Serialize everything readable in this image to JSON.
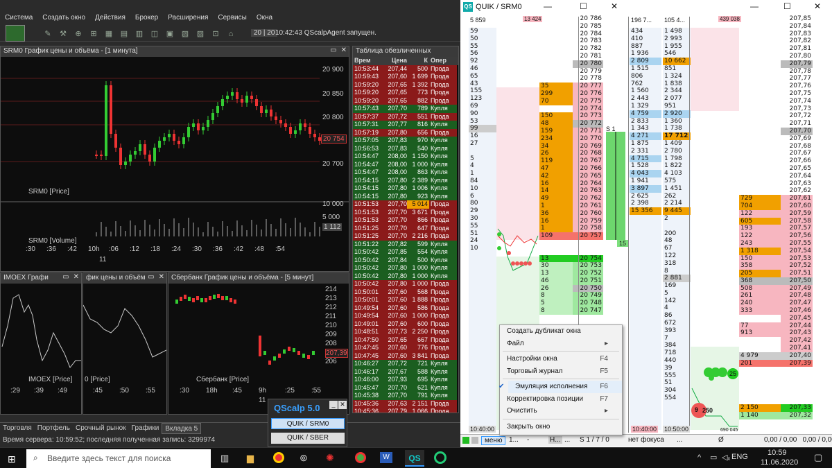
{
  "quik": {
    "menu": [
      "Система",
      "Создать окно",
      "Действия",
      "Брокер",
      "Расширения",
      "Сервисы",
      "Окна"
    ],
    "toolbar_counter": "20 | 20",
    "toolbar_message": "10:42:43 QScalpAgent запущен.",
    "price_chart": {
      "title": "SRM0 График цены и объёма - [1 минута]",
      "price_ticks": [
        "20 900",
        "20 850",
        "20 800",
        "20 754",
        "20 700"
      ],
      "volume_ticks": [
        "10 000",
        "5 000",
        "1 112"
      ],
      "price_legend": "SRM0 [Price]",
      "volume_legend": "SRM0 [Volume]",
      "time_ticks": [
        ":30",
        ":36",
        ":42",
        "10h",
        ":06",
        ":12",
        ":18",
        ":24",
        ":30",
        ":36",
        ":42",
        ":48",
        ":54"
      ],
      "time_sub": "11"
    },
    "imoex_chart": {
      "title": "IMOEX Графи",
      "legend": "IMOEX [Price]",
      "time_ticks": [
        ":29",
        ":39",
        ":49"
      ]
    },
    "mid_chart": {
      "title": "фик цены и объём",
      "legend": "0 [Price]",
      "time_ticks": [
        ":45",
        ":50",
        ":55"
      ]
    },
    "sber_chart": {
      "title": "Сбербанк График цены и объёма - [5 минут]",
      "ticks": [
        "214",
        "213",
        "212",
        "211",
        "210",
        "209",
        "208",
        "207,39",
        "206"
      ],
      "legend": "Сбербанк [Price]",
      "time_ticks": [
        ":30",
        "18h",
        ":45",
        "9h",
        ":25",
        ":55"
      ],
      "time_sub": "11"
    },
    "trades": {
      "title": "Таблица обезличенных",
      "headers": [
        "Врем",
        "Цена",
        "К",
        "Опер"
      ],
      "rows": [
        [
          "10:53:44",
          "207,44",
          "500",
          "Прода",
          "s"
        ],
        [
          "10:59:43",
          "207,60",
          "1 699",
          "Прода",
          "s"
        ],
        [
          "10:59:20",
          "207,65",
          "1 392",
          "Прода",
          "s"
        ],
        [
          "10:59:20",
          "207,65",
          "773",
          "Прода",
          "s"
        ],
        [
          "10:59:20",
          "207,65",
          "882",
          "Прода",
          "s"
        ],
        [
          "10:57:43",
          "207,70",
          "789",
          "Купля",
          "b"
        ],
        [
          "10:57:37",
          "207,72",
          "551",
          "Прода",
          "s"
        ],
        [
          "10:57:31",
          "207,77",
          "816",
          "Купля",
          "b"
        ],
        [
          "10:57:19",
          "207,80",
          "656",
          "Прода",
          "s"
        ],
        [
          "10:57:05",
          "207,83",
          "970",
          "Купля",
          "b"
        ],
        [
          "10:56:53",
          "207,83",
          "540",
          "Купля",
          "b"
        ],
        [
          "10:54:47",
          "208,00",
          "1 150",
          "Купля",
          "b"
        ],
        [
          "10:54:47",
          "208,00",
          "1 000",
          "Купля",
          "b"
        ],
        [
          "10:54:47",
          "208,00",
          "863",
          "Купля",
          "b"
        ],
        [
          "10:54:15",
          "207,80",
          "2 389",
          "Купля",
          "b"
        ],
        [
          "10:54:15",
          "207,80",
          "1 006",
          "Купля",
          "b"
        ],
        [
          "10:54:15",
          "207,80",
          "923",
          "Купля",
          "b"
        ],
        [
          "10:51:53",
          "207,70",
          "5 014",
          "Прода",
          "s"
        ],
        [
          "10:51:53",
          "207,70",
          "3 671",
          "Прода",
          "s"
        ],
        [
          "10:51:53",
          "207,70",
          "866",
          "Прода",
          "s"
        ],
        [
          "10:51:25",
          "207,70",
          "647",
          "Прода",
          "s"
        ],
        [
          "10:51:25",
          "207,70",
          "2 216",
          "Прода",
          "s"
        ],
        [
          "10:51:22",
          "207,82",
          "599",
          "Купля",
          "b"
        ],
        [
          "10:50:42",
          "207,85",
          "554",
          "Купля",
          "b"
        ],
        [
          "10:50:42",
          "207,84",
          "500",
          "Купля",
          "b"
        ],
        [
          "10:50:42",
          "207,80",
          "1 000",
          "Купля",
          "b"
        ],
        [
          "10:50:42",
          "207,80",
          "1 000",
          "Купля",
          "b"
        ],
        [
          "10:50:42",
          "207,80",
          "1 000",
          "Прода",
          "s"
        ],
        [
          "10:50:01",
          "207,60",
          "568",
          "Прода",
          "s"
        ],
        [
          "10:50:01",
          "207,60",
          "1 888",
          "Прода",
          "s"
        ],
        [
          "10:49:54",
          "207,60",
          "586",
          "Прода",
          "s"
        ],
        [
          "10:49:54",
          "207,60",
          "1 000",
          "Прода",
          "s"
        ],
        [
          "10:49:01",
          "207,60",
          "600",
          "Прода",
          "s"
        ],
        [
          "10:48:51",
          "207,73",
          "2 250",
          "Прода",
          "s"
        ],
        [
          "10:47:50",
          "207,65",
          "667",
          "Прода",
          "s"
        ],
        [
          "10:47:45",
          "207,60",
          "776",
          "Прода",
          "s"
        ],
        [
          "10:47:45",
          "207,60",
          "3 841",
          "Прода",
          "s"
        ],
        [
          "10:46:27",
          "207,72",
          "721",
          "Купля",
          "b"
        ],
        [
          "10:46:17",
          "207,67",
          "588",
          "Купля",
          "b"
        ],
        [
          "10:46:00",
          "207,93",
          "695",
          "Купля",
          "b"
        ],
        [
          "10:45:47",
          "207,70",
          "621",
          "Купля",
          "b"
        ],
        [
          "10:45:38",
          "207,70",
          "791",
          "Купля",
          "b"
        ],
        [
          "10:45:36",
          "207,63",
          "2 151",
          "Прода",
          "s"
        ],
        [
          "10:45:36",
          "207,79",
          "1 066",
          "Прода",
          "s"
        ]
      ]
    },
    "tabs": [
      "Торговля",
      "Портфель",
      "Срочный рынок",
      "Графики",
      "Вкладка 5"
    ],
    "active_tab": "Вкладка 5",
    "status": "Время сервера: 10:59:52; последняя полученная запись: 3299974"
  },
  "qscalp_switch": {
    "title": "QScalp 5.0",
    "buttons": [
      "QUIK / SRM0",
      "QUIK / SBER"
    ]
  },
  "qscalp": {
    "title": "QUIK / SRM0",
    "top_left": "5 859",
    "top_ask": "13 424",
    "top2_a": "196 7...",
    "top2_b": "105 4...",
    "top2_c": "439 038",
    "left_col": [
      "59",
      "50",
      "55",
      "56",
      "92",
      "46",
      "65",
      "43",
      "155",
      "123",
      "69",
      "90",
      "53",
      "99",
      "16",
      "27",
      "",
      "5",
      "4",
      "1",
      "84",
      "10",
      "6",
      "80",
      "29",
      "30",
      "55",
      "51",
      "24",
      "10"
    ],
    "dom1": [
      [
        "",
        "20 786",
        "n"
      ],
      [
        "",
        "20 785",
        "n"
      ],
      [
        "",
        "20 784",
        "n"
      ],
      [
        "",
        "20 783",
        "n"
      ],
      [
        "",
        "20 782",
        "n"
      ],
      [
        "",
        "20 781",
        "n"
      ],
      [
        "",
        "20 780",
        "g"
      ],
      [
        "",
        "20 779",
        "n"
      ],
      [
        "",
        "20 778",
        "n"
      ],
      [
        "35",
        "20 777",
        "a"
      ],
      [
        "299",
        "20 776",
        "a"
      ],
      [
        "70",
        "20 775",
        "a"
      ],
      [
        "",
        "20 774",
        "a"
      ],
      [
        "150",
        "20 773",
        "a"
      ],
      [
        "48",
        "20 772",
        "a"
      ],
      [
        "159",
        "20 771",
        "a"
      ],
      [
        "234",
        "20 770",
        "a"
      ],
      [
        "34",
        "20 769",
        "a"
      ],
      [
        "26",
        "20 768",
        "a"
      ],
      [
        "119",
        "20 767",
        "a"
      ],
      [
        "47",
        "20 766",
        "a"
      ],
      [
        "42",
        "20 765",
        "a"
      ],
      [
        "16",
        "20 764",
        "a"
      ],
      [
        "14",
        "20 763",
        "a"
      ],
      [
        "49",
        "20 762",
        "a"
      ],
      [
        "1",
        "20 761",
        "a"
      ],
      [
        "36",
        "20 760",
        "a"
      ],
      [
        "16",
        "20 759",
        "a"
      ],
      [
        "1",
        "20 758",
        "a"
      ],
      [
        "109",
        "20 757",
        "a"
      ],
      [
        "",
        "",
        "n"
      ],
      [
        "",
        "",
        "n"
      ],
      [
        "13",
        "20 754",
        "b"
      ],
      [
        "30",
        "20 753",
        "b"
      ],
      [
        "13",
        "20 752",
        "b"
      ],
      [
        "46",
        "20 751",
        "b"
      ],
      [
        "26",
        "20 750",
        "b"
      ],
      [
        "8",
        "20 749",
        "b"
      ],
      [
        "5",
        "20 748",
        "b"
      ],
      [
        "8",
        "20 747",
        "b"
      ]
    ],
    "dom2_left": [
      "434",
      "410",
      "887",
      "1 936",
      "2 809",
      "1 515",
      "806",
      "762",
      "1 560",
      "2 443",
      "1 329",
      "4 759",
      "2 833",
      "1 343",
      "4 271",
      "1 875",
      "2 331",
      "4 715",
      "1 528",
      "4 043",
      "1 941",
      "3 897",
      "2 625",
      "2 398",
      "15 356"
    ],
    "dom2_right": [
      "1 498",
      "2 993",
      "1 955",
      "546",
      "10 662",
      "851",
      "1 324",
      "1 838",
      "2 344",
      "2 077",
      "951",
      "2 920",
      "1 360",
      "1 738",
      "17 712",
      "1 409",
      "2 780",
      "1 798",
      "1 822",
      "4 103",
      "575",
      "1 451",
      "262",
      "2 214",
      "9 445",
      "2",
      "",
      "200",
      "48",
      "67",
      "122",
      "318",
      "8",
      "2 881",
      "169",
      "5",
      "142",
      "4",
      "86",
      "672",
      "393",
      "7",
      "384",
      "718",
      "440",
      "39",
      "555",
      "51",
      "304",
      "554"
    ],
    "dom3_price": [
      "207,85",
      "207,84",
      "207,83",
      "207,82",
      "207,81",
      "207,80",
      "207,79",
      "207,78",
      "207,77",
      "207,76",
      "207,75",
      "207,74",
      "207,73",
      "207,72",
      "207,71",
      "207,70",
      "207,69",
      "207,68",
      "207,67",
      "207,66",
      "207,65",
      "207,64",
      "207,63",
      "207,62",
      "207,61",
      "207,60",
      "207,59",
      "207,58",
      "207,57",
      "207,56",
      "207,55",
      "207,54",
      "207,53",
      "207,52",
      "207,51",
      "207,50",
      "207,49",
      "207,48",
      "207,47",
      "207,46",
      "207,45",
      "207,44",
      "207,43",
      "207,42",
      "207,41",
      "207,40",
      "207,39",
      "",
      "",
      "",
      "",
      "",
      "207,33",
      "207,32"
    ],
    "dom3_vol": [
      "",
      "",
      "",
      "",
      "",
      "",
      "",
      "",
      "",
      "",
      "",
      "",
      "",
      "",
      "",
      "",
      "",
      "",
      "",
      "",
      "",
      "",
      "",
      "",
      "729",
      "704",
      "122",
      "605",
      "193",
      "122",
      "243",
      "1 318",
      "150",
      "358",
      "205",
      "368",
      "508",
      "261",
      "240",
      "333",
      "",
      "77",
      "913",
      "",
      "",
      "4 979",
      "201",
      "",
      "",
      "",
      "",
      "",
      "2 150",
      "1 140"
    ],
    "time1": "10:40:00",
    "time2": "10:50:00",
    "bubble_a": "25",
    "bubble_b": "250",
    "bubble_c": "9",
    "bottom_num": "690 045",
    "s1_label": "S 1",
    "s1_val": "15",
    "bottom_bar": {
      "menu": "меню",
      "b1": "1...",
      "b2": "-",
      "b3": "Н...",
      "b4": "...",
      "s": "S 1 / 7 / 0",
      "focus": "нет фокуса",
      "dots": "...",
      "zero": "Ø",
      "pnl": "0,00 / 0,00   0,00 / 0,00"
    }
  },
  "context_menu": [
    {
      "label": "Создать дубликат окна",
      "sc": ""
    },
    {
      "label": "Файл",
      "sc": "▸"
    },
    {
      "sep": true
    },
    {
      "label": "Настройки окна",
      "sc": "F4"
    },
    {
      "label": "Торговый журнал",
      "sc": "F5"
    },
    {
      "sep": true
    },
    {
      "label": "Эмуляция исполнения",
      "sc": "F6",
      "check": true
    },
    {
      "label": "Корректировка позиции",
      "sc": "F7"
    },
    {
      "label": "Очистить",
      "sc": "▸"
    },
    {
      "sep": true
    },
    {
      "label": "Закрыть окно",
      "sc": ""
    }
  ],
  "taskbar": {
    "search_placeholder": "Введите здесь текст для поиска",
    "lang": "ENG",
    "time": "10:59",
    "date": "11.06.2020"
  }
}
